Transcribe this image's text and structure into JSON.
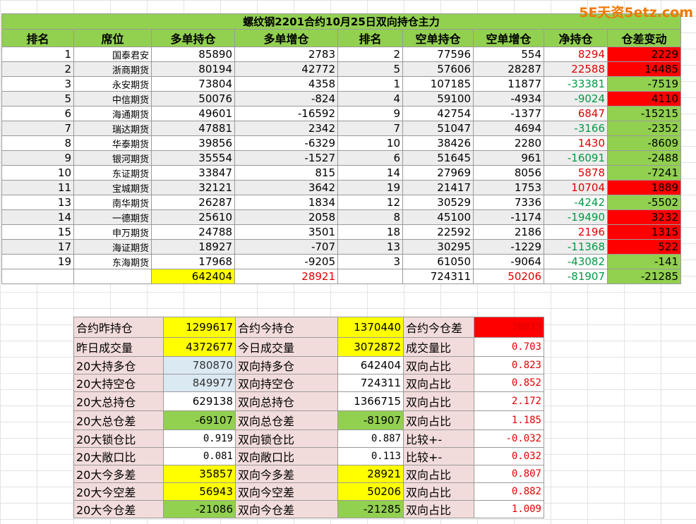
{
  "watermark": "5E天资5etz.com",
  "title": "螺纹钢2201合约10月25日双向持仓主力",
  "headers": [
    "排名",
    "席位",
    "多单持仓",
    "多单增仓",
    "排名",
    "空单持仓",
    "空单增仓",
    "净持仓",
    "仓差变动"
  ],
  "rows": [
    {
      "rank": "1",
      "broker": "国泰君安",
      "long": "85890",
      "long_chg": "2783",
      "srank": "2",
      "short": "77596",
      "short_chg": "554",
      "net": "8294",
      "diff": "2229"
    },
    {
      "rank": "2",
      "broker": "浙商期货",
      "long": "80194",
      "long_chg": "42772",
      "srank": "5",
      "short": "57606",
      "short_chg": "28287",
      "net": "22588",
      "diff": "14485"
    },
    {
      "rank": "3",
      "broker": "永安期货",
      "long": "73804",
      "long_chg": "4358",
      "srank": "1",
      "short": "107185",
      "short_chg": "11877",
      "net": "-33381",
      "diff": "-7519"
    },
    {
      "rank": "5",
      "broker": "中信期货",
      "long": "50076",
      "long_chg": "-824",
      "srank": "4",
      "short": "59100",
      "short_chg": "-4934",
      "net": "-9024",
      "diff": "4110"
    },
    {
      "rank": "6",
      "broker": "海通期货",
      "long": "49601",
      "long_chg": "-16592",
      "srank": "9",
      "short": "42754",
      "short_chg": "-1377",
      "net": "6847",
      "diff": "-15215"
    },
    {
      "rank": "7",
      "broker": "瑞达期货",
      "long": "47881",
      "long_chg": "2342",
      "srank": "7",
      "short": "51047",
      "short_chg": "4694",
      "net": "-3166",
      "diff": "-2352"
    },
    {
      "rank": "8",
      "broker": "华泰期货",
      "long": "39856",
      "long_chg": "-6329",
      "srank": "10",
      "short": "38426",
      "short_chg": "2280",
      "net": "1430",
      "diff": "-8609"
    },
    {
      "rank": "9",
      "broker": "银河期货",
      "long": "35554",
      "long_chg": "-1527",
      "srank": "6",
      "short": "51645",
      "short_chg": "961",
      "net": "-16091",
      "diff": "-2488"
    },
    {
      "rank": "10",
      "broker": "东证期货",
      "long": "33847",
      "long_chg": "815",
      "srank": "14",
      "short": "27969",
      "short_chg": "8056",
      "net": "5878",
      "diff": "-7241"
    },
    {
      "rank": "11",
      "broker": "宝城期货",
      "long": "32121",
      "long_chg": "3642",
      "srank": "19",
      "short": "21417",
      "short_chg": "1753",
      "net": "10704",
      "diff": "1889"
    },
    {
      "rank": "13",
      "broker": "南华期货",
      "long": "26287",
      "long_chg": "1834",
      "srank": "12",
      "short": "30529",
      "short_chg": "7336",
      "net": "-4242",
      "diff": "-5502"
    },
    {
      "rank": "14",
      "broker": "一德期货",
      "long": "25610",
      "long_chg": "2058",
      "srank": "8",
      "short": "45100",
      "short_chg": "-1174",
      "net": "-19490",
      "diff": "3232"
    },
    {
      "rank": "15",
      "broker": "申万期货",
      "long": "24788",
      "long_chg": "3501",
      "srank": "18",
      "short": "22592",
      "short_chg": "2186",
      "net": "2196",
      "diff": "1315"
    },
    {
      "rank": "17",
      "broker": "海证期货",
      "long": "18927",
      "long_chg": "-707",
      "srank": "13",
      "short": "30295",
      "short_chg": "-1229",
      "net": "-11368",
      "diff": "522"
    },
    {
      "rank": "19",
      "broker": "东海期货",
      "long": "17968",
      "long_chg": "-9205",
      "srank": "3",
      "short": "61050",
      "short_chg": "-9064",
      "net": "-43082",
      "diff": "-141"
    }
  ],
  "totals": {
    "long": "642404",
    "long_chg": "28921",
    "short": "724311",
    "short_chg": "50206",
    "net": "-81907",
    "diff": "-21285"
  },
  "summary": [
    {
      "l1": "合约昨持仓",
      "v1": "1299617",
      "l2": "合约今持仓",
      "v2": "1370440",
      "l3": "合约今仓差",
      "v3": "70823"
    },
    {
      "l1": "昨日成交量",
      "v1": "4372677",
      "l2": "今日成交量",
      "v2": "3072872",
      "l3": "成交量比",
      "v3": "0.703"
    },
    {
      "l1": "20大持多仓",
      "v1": "780870",
      "l2": "双向持多仓",
      "v2": "642404",
      "l3": "双向占比",
      "v3": "0.823"
    },
    {
      "l1": "20大持空仓",
      "v1": "849977",
      "l2": "双向持空仓",
      "v2": "724311",
      "l3": "双向占比",
      "v3": "0.852"
    },
    {
      "l1": "20大总持仓",
      "v1": "629138",
      "l2": "双向总持仓",
      "v2": "1366715",
      "l3": "双向占比",
      "v3": "2.172"
    },
    {
      "l1": "20大总仓差",
      "v1": "-69107",
      "l2": "双向总仓差",
      "v2": "-81907",
      "l3": "双向占比",
      "v3": "1.185"
    },
    {
      "l1": "20大锁仓比",
      "v1": "0.919",
      "l2": "双向锁仓比",
      "v2": "0.887",
      "l3": "比较+-",
      "v3": "-0.032"
    },
    {
      "l1": "20大敞口比",
      "v1": "0.081",
      "l2": "双向敞口比",
      "v2": "0.113",
      "l3": "比较+-",
      "v3": "0.032"
    },
    {
      "l1": "20大今多差",
      "v1": "35857",
      "l2": "双向今多差",
      "v2": "28921",
      "l3": "双向占比",
      "v3": "0.807"
    },
    {
      "l1": "20大今空差",
      "v1": "56943",
      "l2": "双向今空差",
      "v2": "50206",
      "l3": "双向占比",
      "v3": "0.882"
    },
    {
      "l1": "20大今仓差",
      "v1": "-21086",
      "l2": "双向今仓差",
      "v2": "-21285",
      "l3": "双向占比",
      "v3": "1.009"
    }
  ],
  "colors": {
    "green_header": "#92d050",
    "red_fill": "#ff0000",
    "yellow_fill": "#ffff00",
    "pink_label": "#f2dcdb",
    "light_blue": "#dbe9f3",
    "red_text": "#e00000",
    "green_text": "#009a44"
  }
}
